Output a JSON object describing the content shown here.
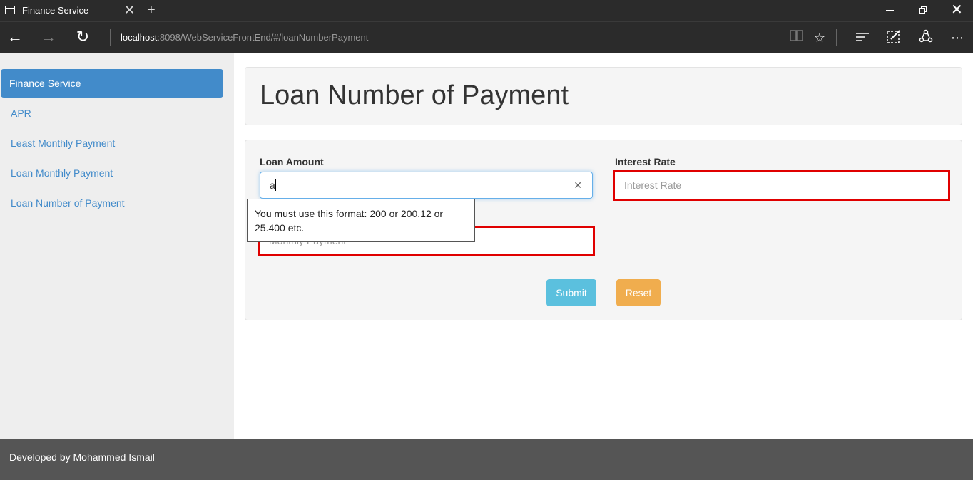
{
  "browser": {
    "tab_title": "Finance Service",
    "url_host": "localhost",
    "url_rest": ":8098/WebServiceFrontEnd/#/loanNumberPayment"
  },
  "sidebar": {
    "items": [
      {
        "label": "Finance Service",
        "active": true
      },
      {
        "label": "APR"
      },
      {
        "label": "Least Monthly Payment"
      },
      {
        "label": "Loan Monthly Payment"
      },
      {
        "label": "Loan Number of Payment"
      }
    ]
  },
  "main": {
    "title": "Loan Number of Payment",
    "form": {
      "loan_amount_label": "Loan Amount",
      "loan_amount_value": "a",
      "interest_rate_label": "Interest Rate",
      "interest_rate_placeholder": "Interest Rate",
      "monthly_payment_placeholder": "Monthly Payment",
      "validation_tooltip": "You must use this format:  200 or 200.12 or 25.400 etc.",
      "submit_label": "Submit",
      "reset_label": "Reset"
    }
  },
  "footer": {
    "text": "Developed by Mohammed Ismail"
  },
  "colors": {
    "brand_blue": "#428bca",
    "submit": "#5bc0de",
    "reset": "#f0ad4e",
    "invalid_border": "#e00000"
  }
}
